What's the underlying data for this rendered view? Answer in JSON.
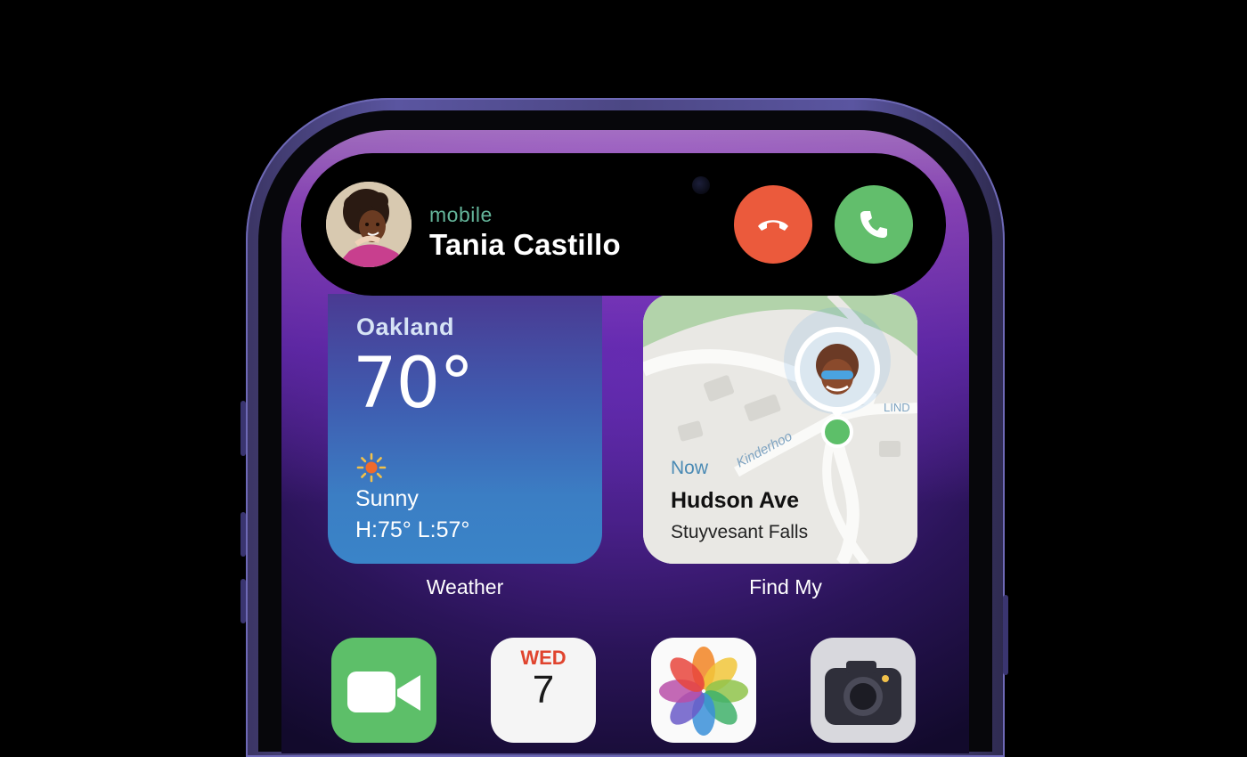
{
  "call": {
    "type_label": "mobile",
    "caller_name": "Tania Castillo",
    "decline_color": "#eb5a3c",
    "accept_color": "#62be6c"
  },
  "weather_widget": {
    "city": "Oakland",
    "temperature": "70°",
    "condition": "Sunny",
    "high_low": "H:75° L:57°",
    "label": "Weather"
  },
  "findmy_widget": {
    "time": "Now",
    "street": "Hudson Ave",
    "locality": "Stuyvesant Falls",
    "map_street_labels": [
      "Kinderhoo",
      "LIND"
    ],
    "label": "Find My"
  },
  "dock_apps": [
    {
      "name": "FaceTime",
      "icon": "facetime-icon"
    },
    {
      "name": "Calendar",
      "icon": "calendar-icon",
      "day": "WED",
      "date": "7"
    },
    {
      "name": "Photos",
      "icon": "photos-icon"
    },
    {
      "name": "Camera",
      "icon": "camera-icon"
    }
  ],
  "colors": {
    "accent_purple": "#6a2cb5",
    "weather_blue": "#3b7ec4"
  }
}
